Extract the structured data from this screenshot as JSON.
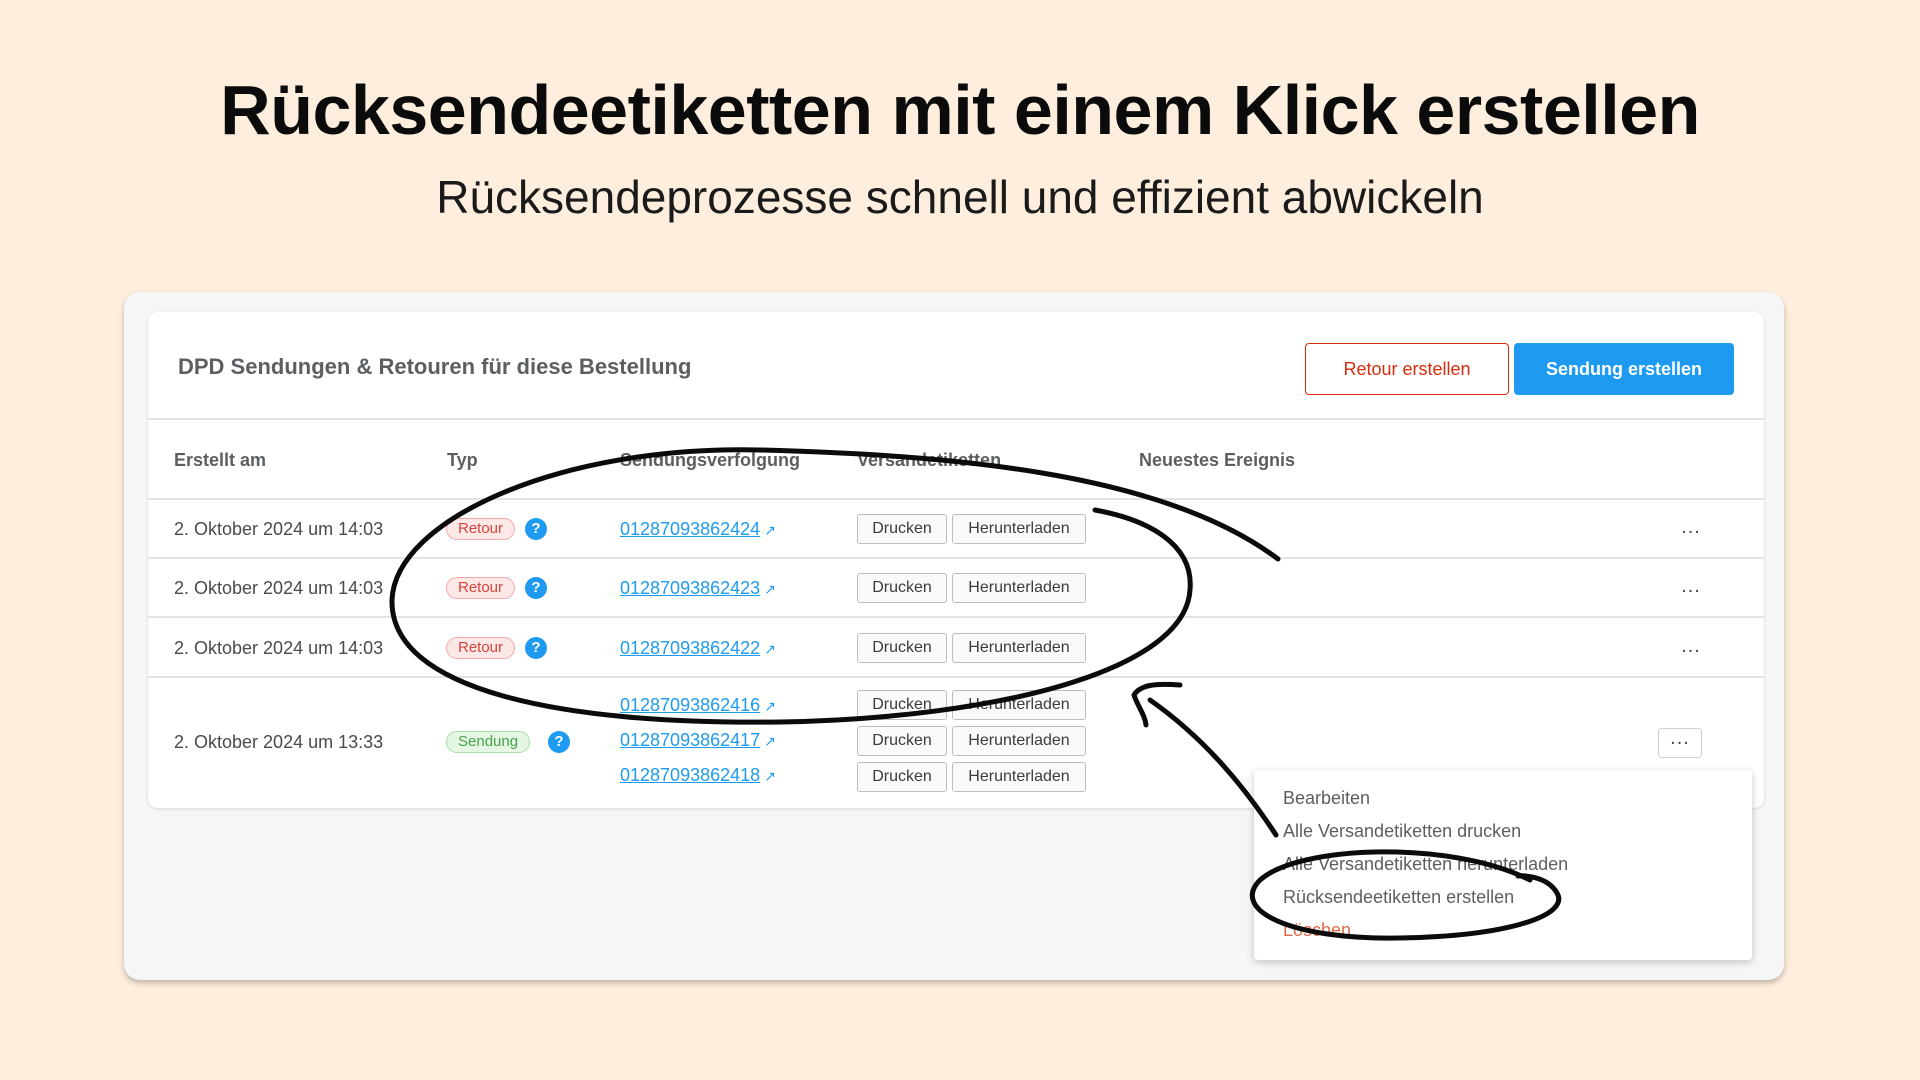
{
  "hero": {
    "title": "Rücksendeetiketten mit einem Klick erstellen",
    "subtitle": "Rücksendeprozesse schnell und effizient abwickeln"
  },
  "card": {
    "title": "DPD Sendungen & Retouren für diese Bestellung",
    "retour_button": "Retour erstellen",
    "sendung_button": "Sendung erstellen"
  },
  "table": {
    "columns": [
      "Erstellt am",
      "Typ",
      "Sendungsverfolgung",
      "Versandetiketten",
      "Neuestes Ereignis"
    ],
    "drucken_label": "Drucken",
    "herunterladen_label": "Herunterladen",
    "help_glyph": "?",
    "more_glyph": "...",
    "rows": [
      {
        "date": "2. Oktober 2024 um 14:03",
        "type": "Retour",
        "tracking": [
          "01287093862424"
        ]
      },
      {
        "date": "2. Oktober 2024 um 14:03",
        "type": "Retour",
        "tracking": [
          "01287093862423"
        ]
      },
      {
        "date": "2. Oktober 2024 um 14:03",
        "type": "Retour",
        "tracking": [
          "01287093862422"
        ]
      },
      {
        "date": "2. Oktober 2024 um 13:33",
        "type": "Sendung",
        "tracking": [
          "01287093862416",
          "01287093862417",
          "01287093862418"
        ]
      }
    ]
  },
  "menu": {
    "items": [
      "Bearbeiten",
      "Alle Versandetiketten drucken",
      "Alle Versandetiketten herunterladen",
      "Rücksendeetiketten erstellen",
      "Löschen"
    ]
  },
  "colors": {
    "background": "#feeedd",
    "accent": "#1e9bf0",
    "danger": "#d72c0d",
    "retour_badge": "#d5453a",
    "sendung_badge": "#4aa04a"
  },
  "icons": [
    "external-link-icon",
    "help-icon",
    "more-icon"
  ]
}
